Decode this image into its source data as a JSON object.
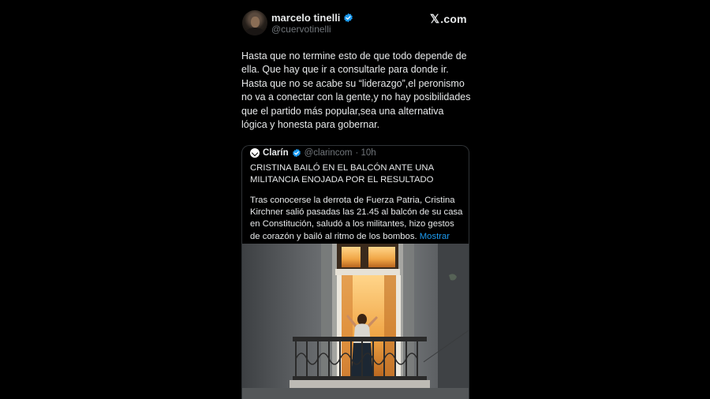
{
  "brand": {
    "site_label": "X.com"
  },
  "author": {
    "name": "marcelo tinelli",
    "handle": "@cuervotinelli"
  },
  "tweet": {
    "text": "Hasta que no termine esto de que todo depende de\nella. Que hay que ir a consultarle para donde ir.\nHasta que no se acabe su “liderazgo”,el peronismo\nno va a conectar con la gente,y no hay posibilidades\nque el partido más popular,sea una alternativa\nlógica y honesta para gobernar."
  },
  "quote": {
    "author_name": "Clarín",
    "author_handle": "@clarincom",
    "time": "· 10h",
    "title": "CRISTINA BAILÓ EN EL BALCÓN ANTE UNA\nMILITANCIA ENOJADA POR EL RESULTADO",
    "body": "Tras conocerse la derrota de Fuerza Patria, Cristina Kirchner salió pasadas las 21.45 al balcón de su casa en Constitución, saludó a los militantes, hizo gestos de corazón y bailó al ritmo de los bombos.",
    "more_label": "Mostrar más"
  },
  "colors": {
    "background": "#000000",
    "text": "#e7e9ea",
    "muted": "#71767b",
    "accent": "#1d9bf0",
    "border": "#2f3336"
  }
}
